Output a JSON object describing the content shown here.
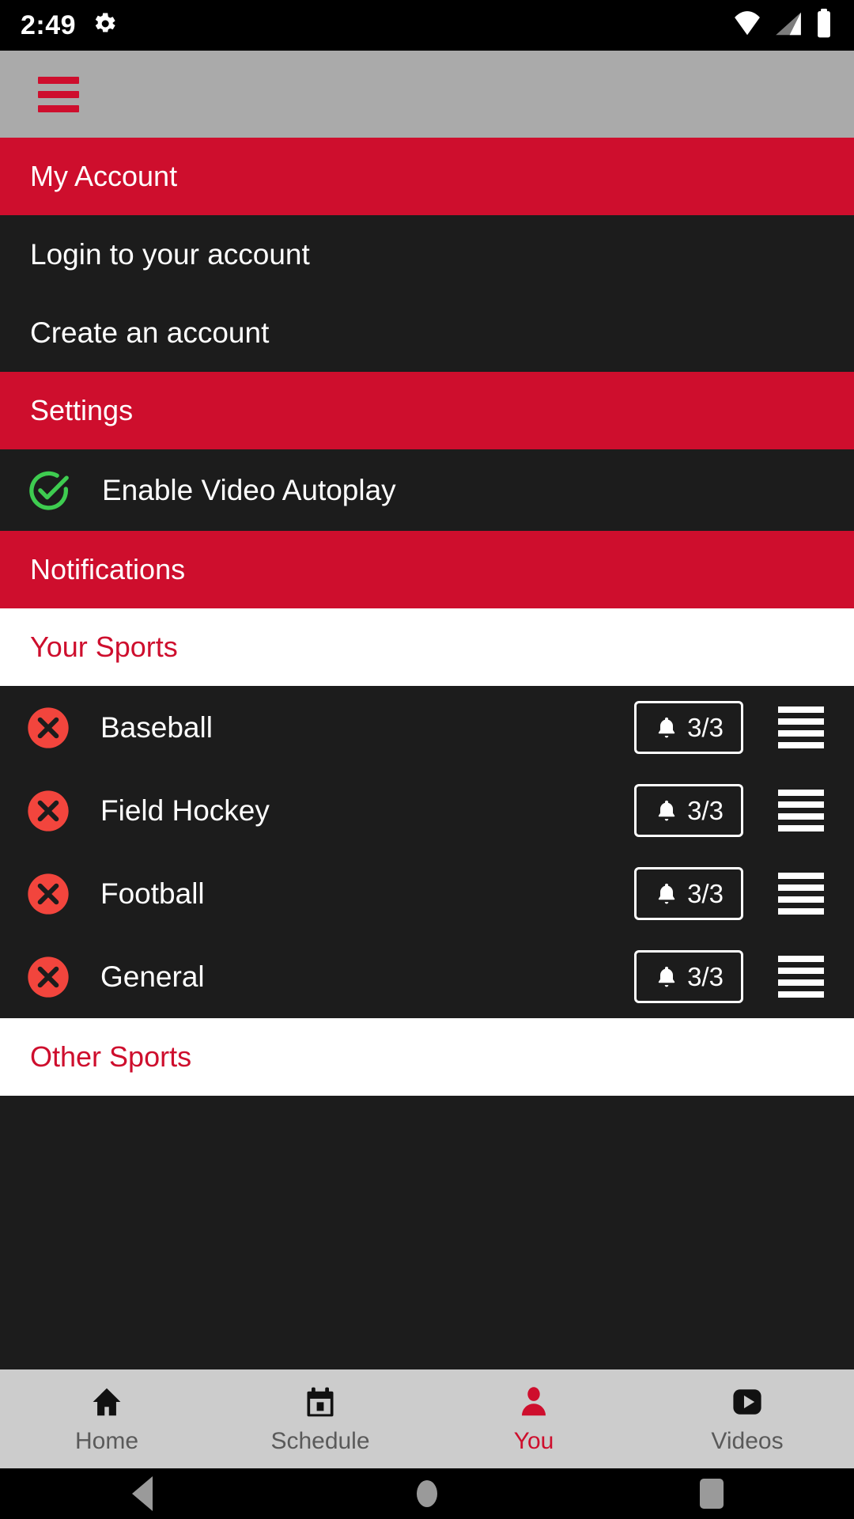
{
  "statusbar": {
    "time": "2:49",
    "icons": [
      "gear-icon",
      "wifi-icon",
      "cell-signal-icon",
      "battery-icon"
    ]
  },
  "appbar": {
    "menu_icon": "hamburger-menu-icon"
  },
  "colors": {
    "brand_red": "#ce0e2d",
    "appbar_gray": "#aaaaaa",
    "surface_dark": "#1c1c1c",
    "check_green": "#3ecc50",
    "remove_red": "#f2453d",
    "bottom_nav_bg": "#cccccc"
  },
  "drawer": {
    "account": {
      "header": "My Account",
      "items": [
        {
          "label": "Login to your account"
        },
        {
          "label": "Create an account"
        }
      ]
    },
    "settings": {
      "header": "Settings",
      "toggles": [
        {
          "label": "Enable Video Autoplay",
          "checked": true,
          "icon": "check-circle-icon"
        }
      ]
    },
    "notifications": {
      "header": "Notifications",
      "your_sports_header": "Your Sports",
      "sports": [
        {
          "name": "Baseball",
          "remove_icon": "remove-circle-icon",
          "bell_icon": "bell-icon",
          "count": "3/3",
          "drag_icon": "drag-handle-icon"
        },
        {
          "name": "Field Hockey",
          "remove_icon": "remove-circle-icon",
          "bell_icon": "bell-icon",
          "count": "3/3",
          "drag_icon": "drag-handle-icon"
        },
        {
          "name": "Football",
          "remove_icon": "remove-circle-icon",
          "bell_icon": "bell-icon",
          "count": "3/3",
          "drag_icon": "drag-handle-icon"
        },
        {
          "name": "General",
          "remove_icon": "remove-circle-icon",
          "bell_icon": "bell-icon",
          "count": "3/3",
          "drag_icon": "drag-handle-icon"
        }
      ],
      "other_sports_header": "Other Sports"
    }
  },
  "bottom_nav": {
    "items": [
      {
        "label": "Home",
        "icon": "home-icon",
        "active": false
      },
      {
        "label": "Schedule",
        "icon": "calendar-icon",
        "active": false
      },
      {
        "label": "You",
        "icon": "person-icon",
        "active": true
      },
      {
        "label": "Videos",
        "icon": "play-icon",
        "active": false
      }
    ]
  },
  "android_nav": {
    "back": "back-triangle-icon",
    "home": "home-circle-icon",
    "recents": "recents-square-icon"
  }
}
